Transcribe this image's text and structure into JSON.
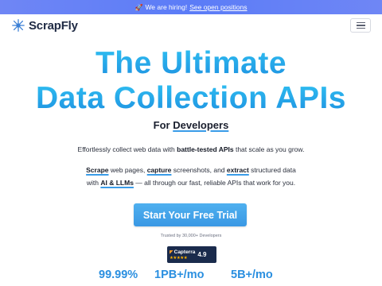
{
  "banner": {
    "rocket": "🚀",
    "text": "We are hiring!",
    "link": "See open positions"
  },
  "nav": {
    "logo_text": "ScrapFly",
    "menu_icon": "hamburger-menu-icon"
  },
  "hero": {
    "title_line1": "The Ultimate",
    "title_line2": "Data Collection APIs",
    "for_prefix": "For",
    "for_highlight": "Developers"
  },
  "description": {
    "line1": {
      "before": "Effortlessly collect web data with ",
      "highlight": "battle-tested APIs",
      "after": " that scale as you grow."
    },
    "line2": {
      "w1": "Scrape",
      "t1": " web pages, ",
      "w2": "capture",
      "t2": " screenshots, and ",
      "w3": "extract",
      "t3": " structured data"
    },
    "line3": {
      "before": "with ",
      "highlight": "AI & LLMs",
      "after": " — all through our fast, reliable APIs that work for you."
    }
  },
  "cta": {
    "label": "Start Your Free Trial"
  },
  "trusted": "Trusted by 30,000+ Developers",
  "capterra": {
    "name": "Capterra",
    "stars": "★★★★★",
    "score": "4.9",
    "rating": 4.9
  },
  "stats": [
    {
      "value": "99.99%"
    },
    {
      "value": "1PB+/mo"
    },
    {
      "value": "5B+/mo"
    }
  ],
  "colors": {
    "banner": "#5b7cf7",
    "accent": "#2a8fe0",
    "title_gradient_top": "#30c1f2",
    "title_gradient_bottom": "#1d8fe0",
    "cta": "#3a98e4",
    "capterra_bg": "#1a2b4c"
  }
}
